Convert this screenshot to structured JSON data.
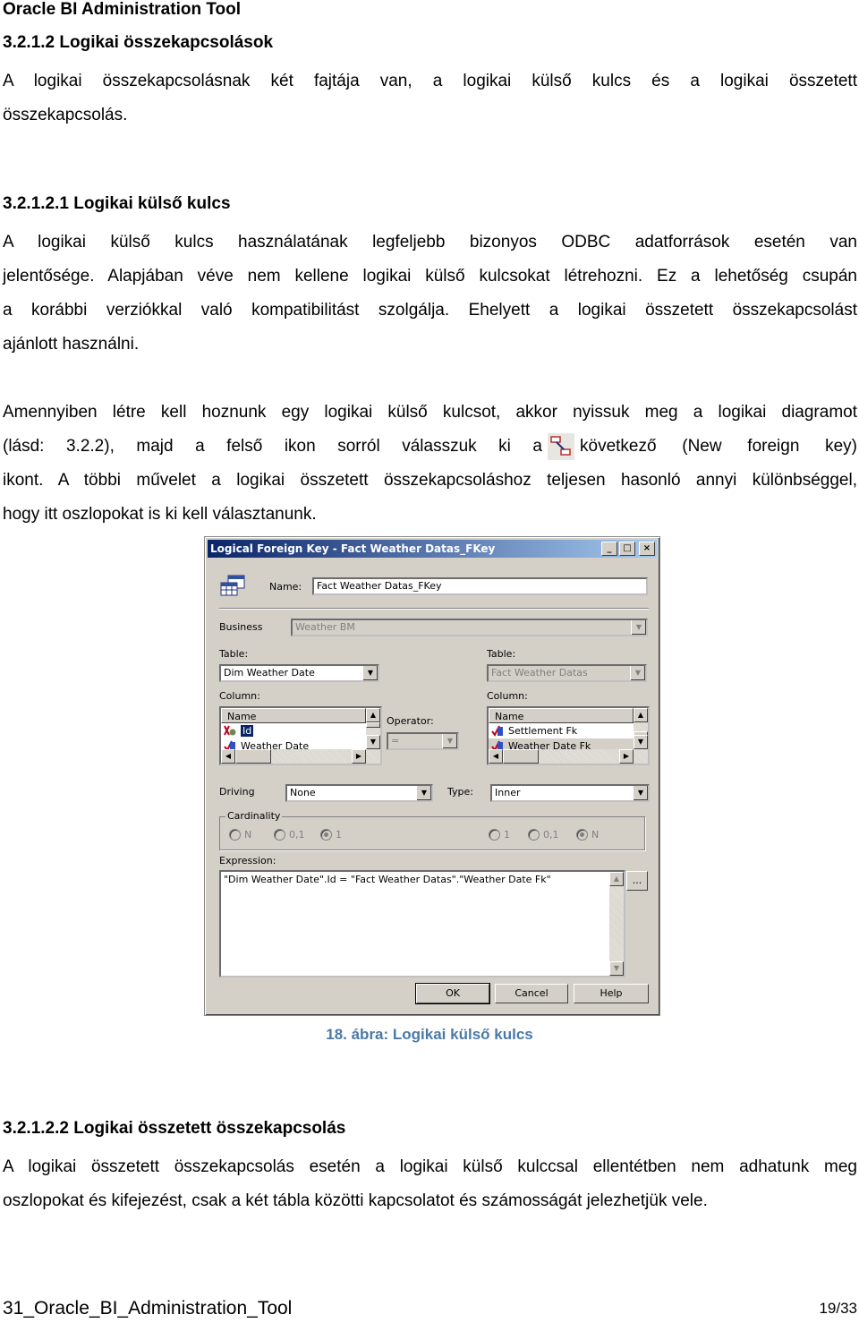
{
  "header": {
    "title": "Oracle BI Administration Tool"
  },
  "section_1": {
    "heading": "3.2.1.2  Logikai összekapcsolások",
    "para_lines": [
      "A logikai összekapcsolásnak két fajtája van, a logikai külső kulcs és a logikai összetett",
      "összekapcsolás."
    ]
  },
  "section_2": {
    "heading": "3.2.1.2.1  Logikai külső kulcs",
    "para1_lines": [
      "A logikai külső kulcs használatának legfeljebb bizonyos ODBC adatforrások esetén van",
      "jelentősége. Alapjában véve nem kellene logikai külső kulcsokat létrehozni. Ez a lehetőség csupán",
      "a korábbi verziókkal való kompatibilitást szolgálja. Ehelyett a logikai összetett összekapcsolást",
      "ajánlott használni."
    ],
    "para2_line1": "Amennyiben létre kell hoznunk egy logikai külső kulcsot, akkor nyissuk meg a logikai diagramot",
    "para2_line2_before": "(lásd: 3.2.2), majd a felső ikon sorról válasszuk ki a",
    "para2_icon": "new-foreign-key-icon",
    "para2_line2_after": "következő (New foreign key)",
    "para2_rest_lines": [
      "ikont. A többi művelet a logikai összetett összekapcsoláshoz teljesen hasonló annyi különbséggel,",
      "hogy itt oszlopokat is ki kell választanunk."
    ]
  },
  "dialog": {
    "title": "Logical Foreign Key - Fact Weather Datas_FKey",
    "title_buttons": [
      "_",
      "□",
      "×"
    ],
    "name_label": "Name:",
    "name_value": "Fact Weather Datas_FKey",
    "business_label": "Business",
    "business_value": "Weather BM",
    "left": {
      "table_label": "Table:",
      "table_value": "Dim Weather Date",
      "column_label": "Column:",
      "list_header": "Name",
      "rows": [
        {
          "label": "Id",
          "selected": true,
          "icon": "key-column-icon"
        },
        {
          "label": "Weather Date",
          "selected": false,
          "icon": "column-icon"
        }
      ]
    },
    "operator_label": "Operator:",
    "operator_value": "=",
    "right": {
      "table_label": "Table:",
      "table_value": "Fact Weather Datas",
      "column_label": "Column:",
      "list_header": "Name",
      "rows": [
        {
          "label": "Settlement Fk",
          "selected": false,
          "icon": "column-icon"
        },
        {
          "label": "Weather Date Fk",
          "selected": false,
          "icon": "column-icon"
        }
      ]
    },
    "driving_label": "Driving",
    "driving_value": "None",
    "type_label": "Type:",
    "type_value": "Inner",
    "cardinality_label": "Cardinality",
    "cardinality_left": [
      {
        "label": "N",
        "checked": false
      },
      {
        "label": "0,1",
        "checked": false
      },
      {
        "label": "1",
        "checked": true
      }
    ],
    "cardinality_right": [
      {
        "label": "1",
        "checked": false
      },
      {
        "label": "0,1",
        "checked": false
      },
      {
        "label": "N",
        "checked": true
      }
    ],
    "expression_label": "Expression:",
    "expression_value": "\"Dim Weather Date\".Id = \"Fact Weather Datas\".\"Weather Date Fk\"",
    "ellipsis_label": "...",
    "ok_label": "OK",
    "cancel_label": "Cancel",
    "help_label": "Help"
  },
  "caption": "18. ábra: Logikai külső kulcs",
  "section_3": {
    "heading": "3.2.1.2.2  Logikai összetett összekapcsolás",
    "para_lines": [
      "A logikai összetett összekapcsolás esetén a logikai külső kulccsal ellentétben nem adhatunk meg",
      "oszlopokat és kifejezést, csak a két tábla közötti kapcsolatot és számosságát jelezhetjük vele."
    ]
  },
  "footer": {
    "doc_name": "31_Oracle_BI_Administration_Tool",
    "page": "19/33"
  }
}
